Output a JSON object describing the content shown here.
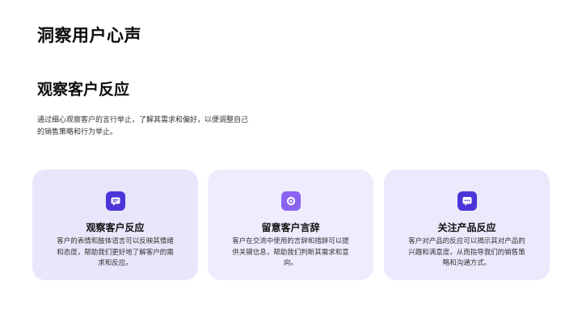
{
  "page": {
    "title": "洞察用户心声"
  },
  "section": {
    "title": "观察客户反应",
    "description": "通过细心观察客户的言行举止，了解其需求和偏好，以便调整自己的销售策略和行为举止。"
  },
  "cards": [
    {
      "icon": "chat-bubble-icon",
      "icon_color": "#4c35d8",
      "title": "观察客户反应",
      "text": "客户的表情和肢体语言可以反映其情绪和态度，帮助我们更好地了解客户的需求和反应。"
    },
    {
      "icon": "target-icon",
      "icon_color": "#8a63f2",
      "title": "留意客户言辞",
      "text": "客户在交流中使用的言辞和措辞可以提供关键信息，帮助我们判断其需求和意向。"
    },
    {
      "icon": "message-dots-icon",
      "icon_color": "#4c35d8",
      "title": "关注产品反应",
      "text": "客户对产品的反应可以揭示其对产品的兴趣和满意度，从而指导我们的销售策略和沟通方式。"
    }
  ]
}
